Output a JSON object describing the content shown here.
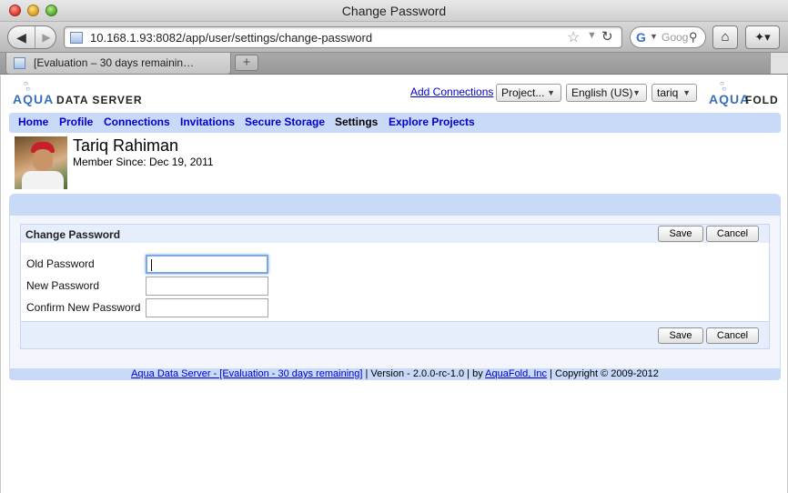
{
  "window": {
    "title": "Change Password"
  },
  "browser": {
    "url": "10.168.1.93:8082/app/user/settings/change-password",
    "search_placeholder": "Goog",
    "tab_label": "[Evaluation – 30 days remainin…",
    "new_tab_label": "+"
  },
  "header": {
    "logo_left_word1": "AQUA",
    "logo_left_word2": "DATA SERVER",
    "logo_right_word1": "AQUA",
    "logo_right_word2": "FOLD",
    "add_connections": "Add Connections",
    "project_select": "Project...",
    "language_select": "English (US)",
    "user_select": "tariq"
  },
  "nav": {
    "items": [
      {
        "label": "Home"
      },
      {
        "label": "Profile"
      },
      {
        "label": "Connections"
      },
      {
        "label": "Invitations"
      },
      {
        "label": "Secure Storage"
      },
      {
        "label": "Settings"
      },
      {
        "label": "Explore Projects"
      }
    ],
    "active": "Settings"
  },
  "profile": {
    "name": "Tariq Rahiman",
    "member_since": "Member Since: Dec 19, 2011"
  },
  "form": {
    "title": "Change Password",
    "save_label": "Save",
    "cancel_label": "Cancel",
    "fields": [
      {
        "label": "Old Password",
        "value": ""
      },
      {
        "label": "New Password",
        "value": ""
      },
      {
        "label": "Confirm New Password",
        "value": ""
      }
    ]
  },
  "footer": {
    "product_link": "Aqua Data Server - [Evaluation - 30 days remaining]",
    "version_text": " | Version - 2.0.0-rc-1.0 | by ",
    "company_link": "AquaFold, Inc",
    "copyright_text": " | Copyright © 2009-2012"
  },
  "colors": {
    "nav_band": "#c8daf8",
    "link": "#0000cc",
    "panel_header": "#e6eefb"
  },
  "icons": [
    "back-icon",
    "forward-icon",
    "bookmark-star-icon",
    "reload-icon",
    "google-icon",
    "search-icon",
    "home-icon",
    "bookmarks-icon",
    "favicon-icon"
  ]
}
